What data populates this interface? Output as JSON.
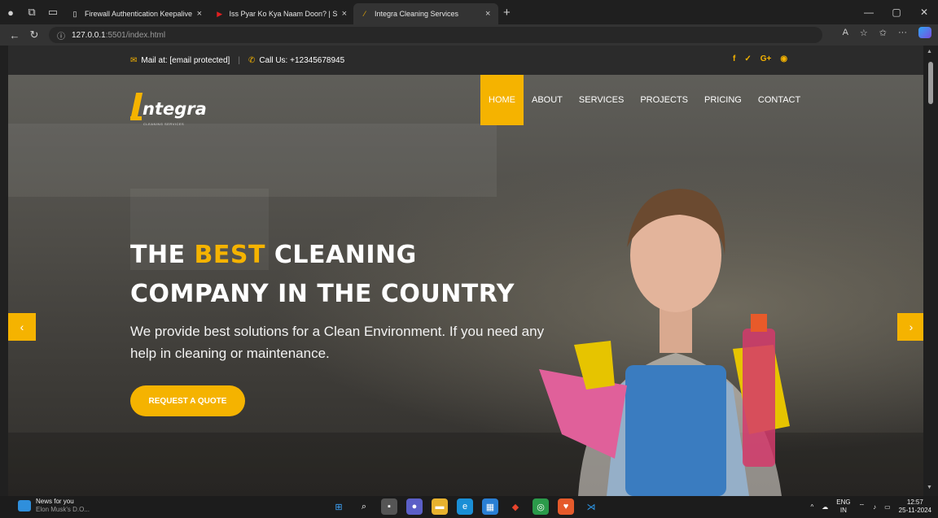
{
  "browser": {
    "tabs": [
      {
        "label": "Firewall Authentication Keepalive",
        "favicon": "page-icon",
        "active": false
      },
      {
        "label": "Iss Pyar Ko Kya Naam Doon? | Se",
        "favicon": "youtube-icon",
        "active": false
      },
      {
        "label": "Integra Cleaning Services",
        "favicon": "integra-favicon",
        "active": true
      }
    ],
    "url_host": "127.0.0.1",
    "url_rest": ":5501/index.html",
    "new_tab_symbol": "+"
  },
  "topbar": {
    "mail_label": "Mail at: [email protected]",
    "separator": "|",
    "call_label": "Call Us: +12345678945",
    "social": [
      "f",
      "t",
      "G+",
      "dribbble"
    ]
  },
  "site": {
    "logo_text": "ntegra",
    "logo_sub": "CLEANING SERVICES",
    "nav": [
      {
        "label": "HOME",
        "active": true
      },
      {
        "label": "ABOUT",
        "active": false
      },
      {
        "label": "SERVICES",
        "active": false
      },
      {
        "label": "PROJECTS",
        "active": false
      },
      {
        "label": "PRICING",
        "active": false
      },
      {
        "label": "CONTACT",
        "active": false
      }
    ]
  },
  "hero": {
    "title_line1_pre": "THE ",
    "title_line1_accent": "BEST",
    "title_line1_post": " CLEANING",
    "title_line2": "COMPANY IN THE COUNTRY",
    "lead": "We provide best solutions for a Clean Environment. If you need any help in cleaning or maintenance.",
    "cta_label": "REQUEST A QUOTE",
    "prev_symbol": "‹",
    "next_symbol": "›"
  },
  "taskbar": {
    "news_title": "News for you",
    "news_sub": "Elon Musk's D.O...",
    "lang_top": "ENG",
    "lang_bottom": "IN",
    "time": "12:57",
    "date": "25-11-2024"
  },
  "colors": {
    "accent": "#f5b300",
    "topbar_bg": "#2b2b2b"
  }
}
